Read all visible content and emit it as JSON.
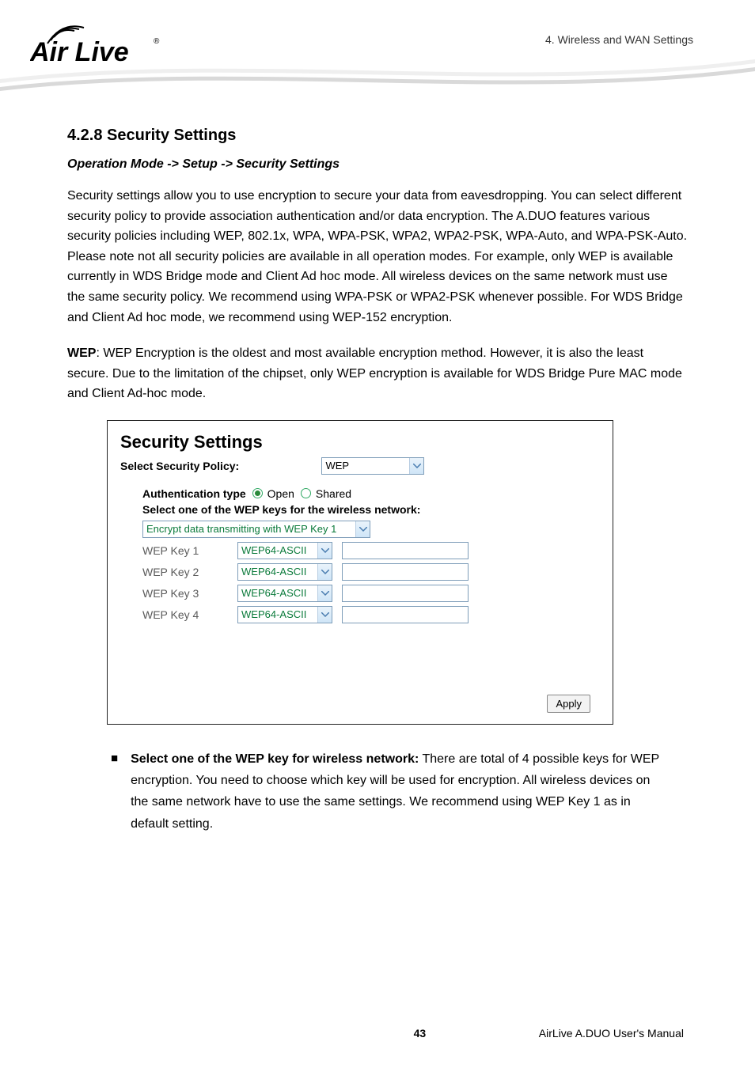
{
  "header": {
    "breadcrumb": "4. Wireless and WAN Settings",
    "logo_text": "Air Live",
    "logo_mark": "®"
  },
  "section": {
    "number_title": "4.2.8 Security Settings",
    "path": "Operation Mode -> Setup -> Security Settings",
    "para1": "Security settings allow you to use encryption to secure your data from eavesdropping. You can select different security policy to provide association authentication and/or data encryption. The A.DUO features various security policies including WEP, 802.1x, WPA, WPA-PSK, WPA2, WPA2-PSK, WPA-Auto, and WPA-PSK-Auto. Please note not all security policies are available in all operation modes. For example, only WEP is available currently in WDS Bridge mode and Client Ad hoc mode. All wireless devices on the same network must use the same security policy. We recommend using WPA-PSK or WPA2-PSK whenever possible. For WDS Bridge and Client Ad hoc mode, we recommend using WEP-152 encryption.",
    "wep_label": "WEP",
    "wep_text": ": WEP Encryption is the oldest and most available encryption method. However, it is also the least secure. Due to the limitation of the chipset, only WEP encryption is available for WDS Bridge Pure MAC mode and Client Ad-hoc mode."
  },
  "panel": {
    "title": "Security Settings",
    "policy_label": "Select Security Policy:",
    "policy_value": "WEP",
    "auth_label": "Authentication type",
    "auth_open": "Open",
    "auth_shared": "Shared",
    "select_one": "Select one of the WEP keys for the wireless network:",
    "encrypt_select": "Encrypt data transmitting with WEP Key 1",
    "keys": [
      {
        "label": "WEP Key 1",
        "type": "WEP64-ASCII"
      },
      {
        "label": "WEP Key 2",
        "type": "WEP64-ASCII"
      },
      {
        "label": "WEP Key 3",
        "type": "WEP64-ASCII"
      },
      {
        "label": "WEP Key 4",
        "type": "WEP64-ASCII"
      }
    ],
    "apply": "Apply"
  },
  "bullet": {
    "lead_bold": "Select one of the WEP key for wireless network:",
    "lead_rest": " There are total of 4 possible keys for WEP encryption. You need to choose which key will be used for encryption. All wireless devices on the same network have to use the same settings. We recommend using WEP Key 1 as in default setting."
  },
  "footer": {
    "page": "43",
    "manual": "AirLive A.DUO User's Manual"
  }
}
